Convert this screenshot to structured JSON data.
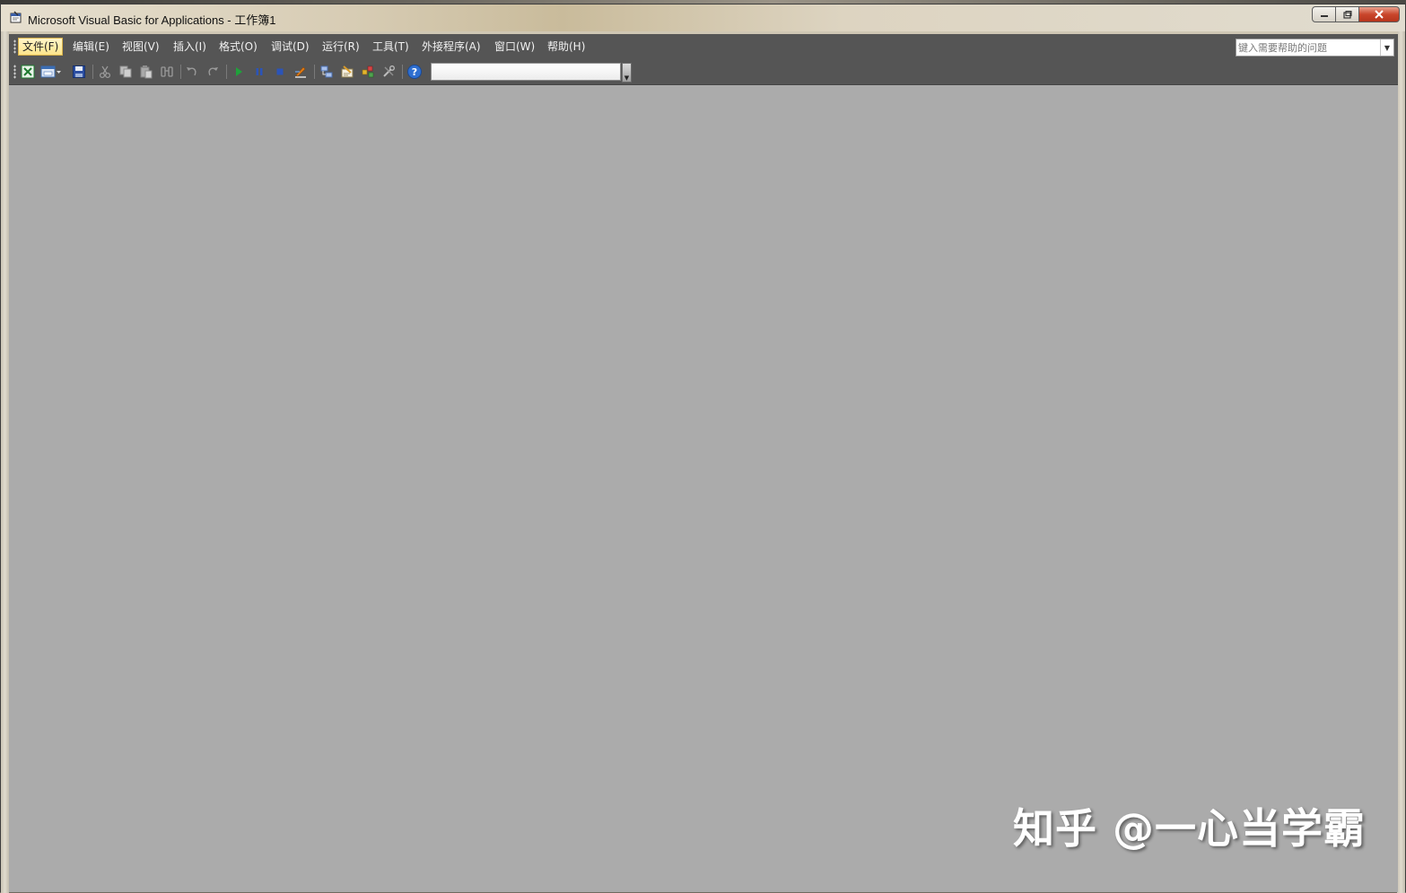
{
  "window": {
    "title": "Microsoft Visual Basic for Applications - 工作簿1"
  },
  "menubar": {
    "items": [
      {
        "id": "file",
        "label": "文件(F)",
        "active": true
      },
      {
        "id": "edit",
        "label": "编辑(E)"
      },
      {
        "id": "view",
        "label": "视图(V)"
      },
      {
        "id": "insert",
        "label": "插入(I)"
      },
      {
        "id": "format",
        "label": "格式(O)"
      },
      {
        "id": "debug",
        "label": "调试(D)"
      },
      {
        "id": "run",
        "label": "运行(R)"
      },
      {
        "id": "tools",
        "label": "工具(T)"
      },
      {
        "id": "addins",
        "label": "外接程序(A)"
      },
      {
        "id": "window",
        "label": "窗口(W)"
      },
      {
        "id": "help",
        "label": "帮助(H)"
      }
    ],
    "help_search": {
      "placeholder": "键入需要帮助的问题",
      "value": ""
    }
  },
  "toolbar": {
    "buttons": [
      {
        "name": "view-excel-icon",
        "color": "#1d7a2e"
      },
      {
        "name": "insert-userform-icon",
        "color": "#3b6db3"
      },
      {
        "name": "save-icon",
        "color": "#2c4fa3"
      },
      {
        "name": "cut-icon",
        "color": "#9a9a9a"
      },
      {
        "name": "copy-icon",
        "color": "#9a9a9a"
      },
      {
        "name": "paste-icon",
        "color": "#9a9a9a"
      },
      {
        "name": "find-icon",
        "color": "#9a9a9a"
      },
      {
        "name": "undo-icon",
        "color": "#9a9a9a"
      },
      {
        "name": "redo-icon",
        "color": "#9a9a9a"
      },
      {
        "name": "run-icon",
        "color": "#1fa23b"
      },
      {
        "name": "break-icon",
        "color": "#2b54b8"
      },
      {
        "name": "reset-icon",
        "color": "#2b54b8"
      },
      {
        "name": "design-mode-icon",
        "color": "#e07b18"
      },
      {
        "name": "project-explorer-icon",
        "color": "#6a8fd4"
      },
      {
        "name": "properties-window-icon",
        "color": "#d89b2a"
      },
      {
        "name": "object-browser-icon",
        "color": "#e2b52e"
      },
      {
        "name": "toolbox-icon",
        "color": "#a0a0a0"
      },
      {
        "name": "help-icon",
        "color": "#2f6fd0"
      }
    ],
    "position_field": ""
  },
  "watermark": {
    "text": "知乎 @一心当学霸"
  }
}
